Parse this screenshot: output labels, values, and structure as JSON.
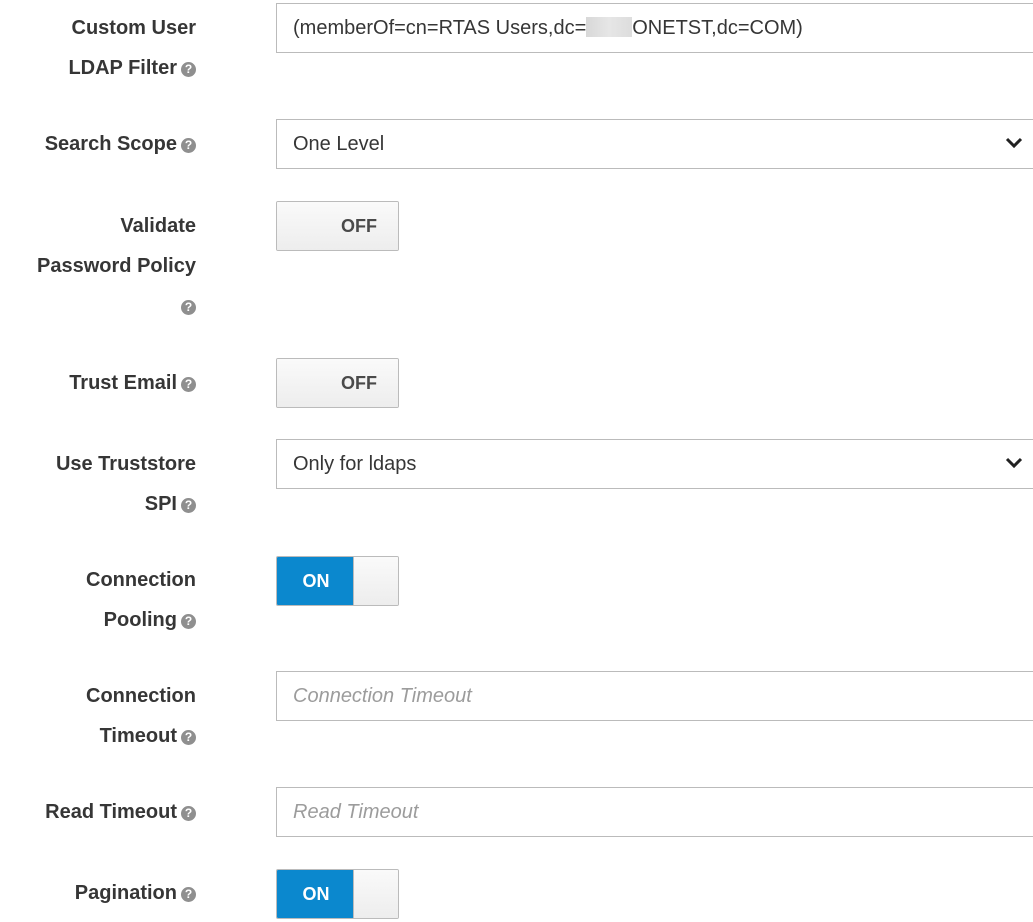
{
  "help_glyph": "?",
  "fields": {
    "custom_user_ldap_filter": {
      "label_lines": [
        "Custom User",
        "LDAP Filter"
      ],
      "value_prefix": "(memberOf=cn=RTAS Users,dc=",
      "value_suffix": "ONETST,dc=COM)"
    },
    "search_scope": {
      "label_lines": [
        "Search Scope"
      ],
      "selected": "One Level"
    },
    "validate_password_policy": {
      "label_lines": [
        "Validate",
        "Password Policy"
      ],
      "state": "OFF"
    },
    "trust_email": {
      "label_lines": [
        "Trust Email"
      ],
      "state": "OFF"
    },
    "use_truststore_spi": {
      "label_lines": [
        "Use Truststore",
        "SPI"
      ],
      "selected": "Only for ldaps"
    },
    "connection_pooling": {
      "label_lines": [
        "Connection",
        "Pooling"
      ],
      "state": "ON"
    },
    "connection_timeout": {
      "label_lines": [
        "Connection",
        "Timeout"
      ],
      "placeholder": "Connection Timeout",
      "value": ""
    },
    "read_timeout": {
      "label_lines": [
        "Read Timeout"
      ],
      "placeholder": "Read Timeout",
      "value": ""
    },
    "pagination": {
      "label_lines": [
        "Pagination"
      ],
      "state": "ON"
    }
  },
  "colors": {
    "toggle_on": "#0b88ce",
    "label_text": "#363636",
    "help_icon": "#8f8f8f",
    "placeholder_text": "#9c9c9c",
    "border": "#bbbbbb"
  },
  "icons": {
    "help": "question-circle-icon",
    "dropdown": "chevron-down-icon"
  }
}
